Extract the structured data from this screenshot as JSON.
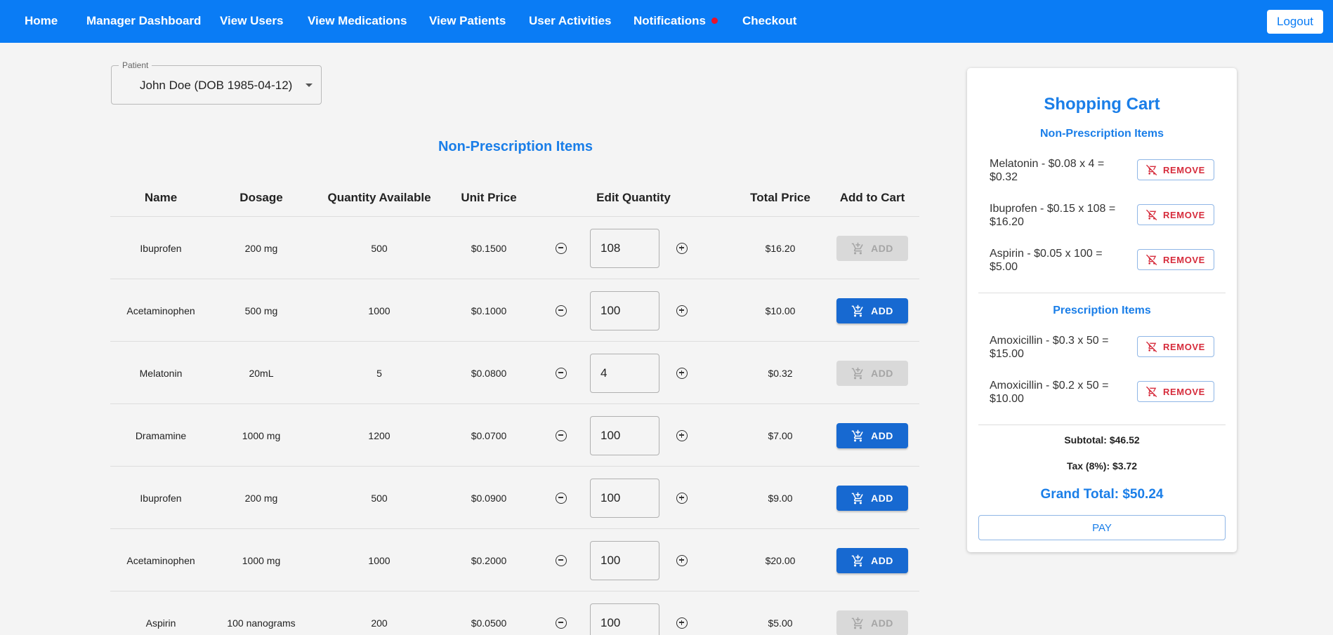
{
  "nav": {
    "items": [
      "Home",
      "Manager Dashboard",
      "View Users",
      "View Medications",
      "View Patients",
      "User Activities",
      "Notifications",
      "Checkout"
    ],
    "logout": "Logout"
  },
  "patient": {
    "label": "Patient",
    "value": "John Doe (DOB 1985-04-12)"
  },
  "section_title": "Non-Prescription Items",
  "table": {
    "headers": [
      "Name",
      "Dosage",
      "Quantity Available",
      "Unit Price",
      "Edit Quantity",
      "Total Price",
      "Add to Cart"
    ],
    "add_label": "ADD",
    "rows": [
      {
        "name": "Ibuprofen",
        "dosage": "200 mg",
        "available": "500",
        "unit_price": "$0.1500",
        "qty": "108",
        "total": "$16.20",
        "add_enabled": false
      },
      {
        "name": "Acetaminophen",
        "dosage": "500 mg",
        "available": "1000",
        "unit_price": "$0.1000",
        "qty": "100",
        "total": "$10.00",
        "add_enabled": true
      },
      {
        "name": "Melatonin",
        "dosage": "20mL",
        "available": "5",
        "unit_price": "$0.0800",
        "qty": "4",
        "total": "$0.32",
        "add_enabled": false
      },
      {
        "name": "Dramamine",
        "dosage": "1000 mg",
        "available": "1200",
        "unit_price": "$0.0700",
        "qty": "100",
        "total": "$7.00",
        "add_enabled": true
      },
      {
        "name": "Ibuprofen",
        "dosage": "200 mg",
        "available": "500",
        "unit_price": "$0.0900",
        "qty": "100",
        "total": "$9.00",
        "add_enabled": true
      },
      {
        "name": "Acetaminophen",
        "dosage": "1000 mg",
        "available": "1000",
        "unit_price": "$0.2000",
        "qty": "100",
        "total": "$20.00",
        "add_enabled": true
      },
      {
        "name": "Aspirin",
        "dosage": "100 nanograms",
        "available": "200",
        "unit_price": "$0.0500",
        "qty": "100",
        "total": "$5.00",
        "add_enabled": false
      }
    ]
  },
  "cart": {
    "title": "Shopping Cart",
    "non_rx_title": "Non-Prescription Items",
    "non_rx_items": [
      "Melatonin - $0.08 x 4 = $0.32",
      "Ibuprofen - $0.15 x 108 = $16.20",
      "Aspirin - $0.05 x 100 = $5.00"
    ],
    "rx_title": "Prescription Items",
    "rx_items": [
      "Amoxicillin - $0.3 x 50 = $15.00",
      "Amoxicillin - $0.2 x 50 = $10.00"
    ],
    "remove_label": "REMOVE",
    "subtotal": "Subtotal: $46.52",
    "tax": "Tax (8%): $3.72",
    "grand_total": "Grand Total: $50.24",
    "pay": "PAY"
  },
  "colors": {
    "primary": "#0a7cf5",
    "accent_text": "#1a7ee8",
    "add_button": "#1769d1",
    "remove_text": "#d62b3b",
    "notification_dot": "#e8132b"
  }
}
